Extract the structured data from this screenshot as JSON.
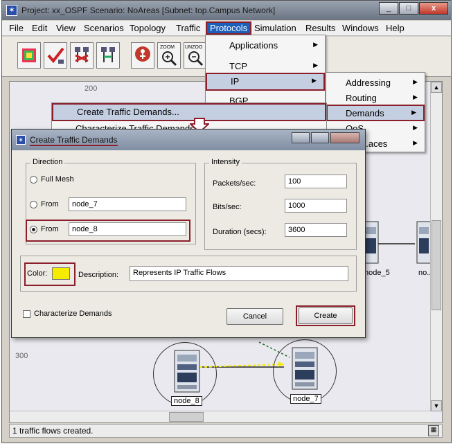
{
  "window": {
    "title": "Project: xx_OSPF Scenario: NoAreas  [Subnet: top.Campus Network]",
    "minimize": "_",
    "maximize": "□",
    "close": "x"
  },
  "menubar": [
    "File",
    "Edit",
    "View",
    "Scenarios",
    "Topology",
    "Traffic",
    "Protocols",
    "Simulation",
    "Results",
    "Windows",
    "Help"
  ],
  "toolbar": {
    "zoom_label": "ZOOM",
    "unzoom_label": "UNZOO"
  },
  "protocols_menu": [
    "Applications",
    "TCP",
    "IP",
    "BGP"
  ],
  "ip_submenu": [
    "Addressing",
    "Routing",
    "Demands",
    "QoS",
    "...aces"
  ],
  "demands_submenu": [
    "Create Traffic Demands...",
    "Characterize Traffic Demands..."
  ],
  "canvas": {
    "ruler_200": "200",
    "ruler_300": "300",
    "nodes": [
      "node_8",
      "node_7",
      "node_5",
      "no..."
    ]
  },
  "dialog": {
    "title": "Create Traffic Demands",
    "direction_label": "Direction",
    "full_mesh": "Full Mesh",
    "from_label_1": "From",
    "from_value_1": "node_7",
    "from_label_2": "From",
    "from_value_2": "node_8",
    "intensity_label": "Intensity",
    "packets_label": "Packets/sec:",
    "packets_value": "100",
    "bits_label": "Bits/sec:",
    "bits_value": "1000",
    "duration_label": "Duration (secs):",
    "duration_value": "3600",
    "color_label": "Color:",
    "color_value": "#f5ec00",
    "description_label": "Description:",
    "description_value": "Represents IP Traffic Flows",
    "characterize_label": "Characterize Demands",
    "cancel": "Cancel",
    "create": "Create"
  },
  "status": {
    "message": "1 traffic flows created."
  },
  "colors": {
    "highlight_border": "#8a1e2b",
    "menu_active": "#1c5fb8",
    "traffic_flow": "#f5ec00"
  }
}
